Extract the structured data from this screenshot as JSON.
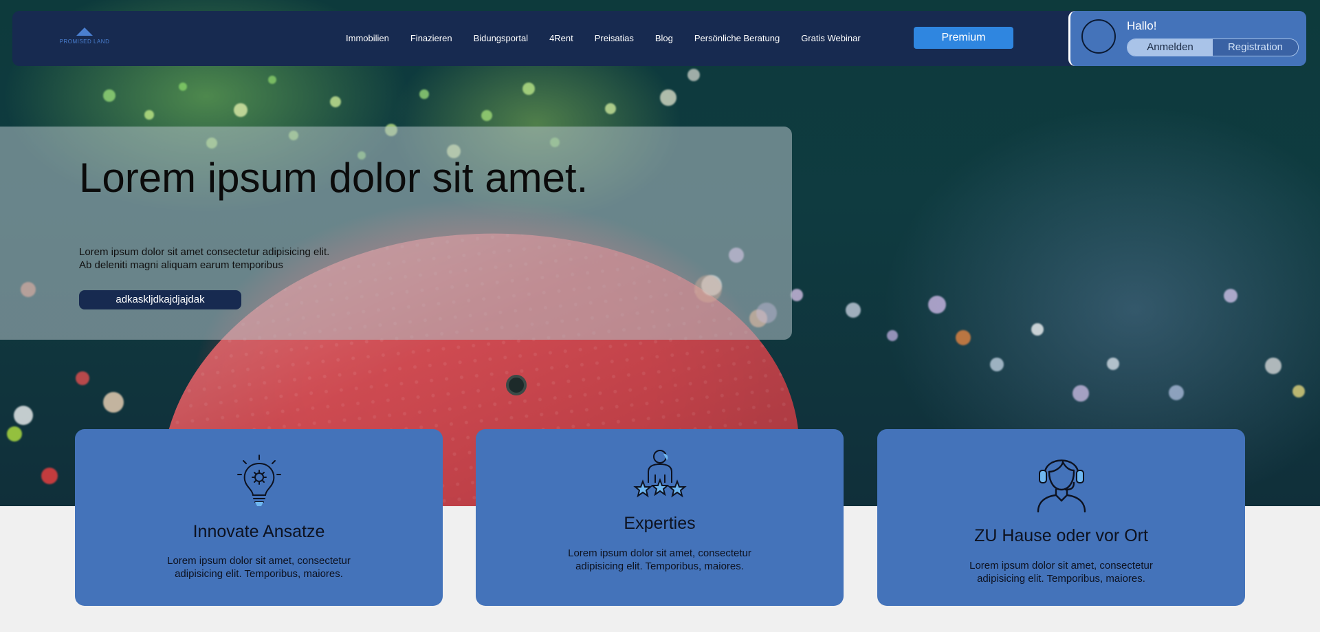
{
  "brand": {
    "logo_text": "PROMISED LAND"
  },
  "nav": {
    "links": [
      "Immobilien",
      "Finazieren",
      "Bidungsportal",
      "4Rent",
      "Preisatias",
      "Blog",
      "Persönliche Beratung",
      "Gratis Webinar"
    ],
    "premium_label": "Premium"
  },
  "user": {
    "greeting": "Hallo!",
    "login_label": "Anmelden",
    "register_label": "Registration"
  },
  "hero": {
    "title": "Lorem ipsum dolor sit amet.",
    "text_line1": "Lorem ipsum dolor sit amet consectetur adipisicing elit.",
    "text_line2": "Ab deleniti magni aliquam earum temporibus",
    "button_label": "adkaskljdkajdjajdak"
  },
  "features": [
    {
      "title": "Innovate Ansatze",
      "text": "Lorem ipsum dolor sit amet, consectetur adipisicing elit. Temporibus, maiores.",
      "icon": "lightbulb-gear-icon"
    },
    {
      "title": "Experties",
      "text": "Lorem ipsum dolor sit amet, consectetur adipisicing elit. Temporibus, maiores.",
      "icon": "expert-rating-icon"
    },
    {
      "title": "ZU Hause oder vor Ort",
      "text": "Lorem ipsum dolor sit amet, consectetur adipisicing elit. Temporibus, maiores.",
      "icon": "headset-support-icon"
    }
  ],
  "colors": {
    "navy": "#172a50",
    "card_blue": "#4473ba",
    "premium_blue": "#2f86e0"
  }
}
